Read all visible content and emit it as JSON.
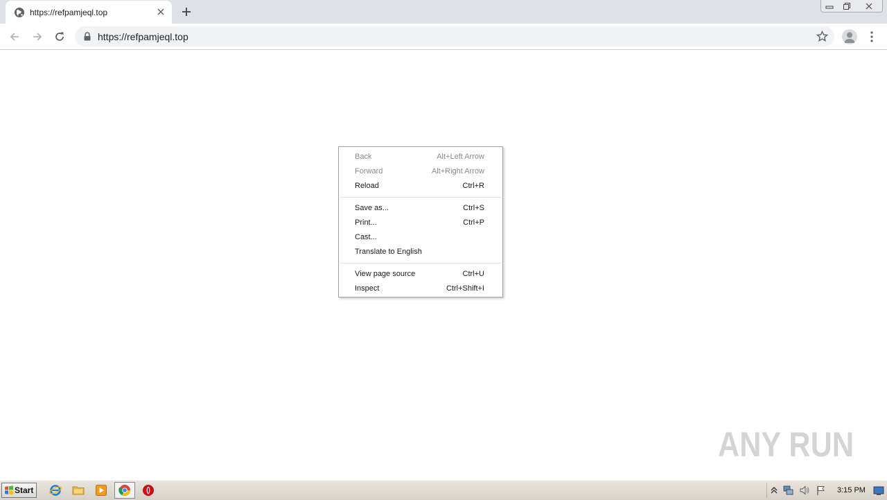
{
  "browser": {
    "tab_title": "https://refpamjeql.top",
    "url": "https://refpamjeql.top"
  },
  "context_menu": {
    "items": [
      {
        "label": "Back",
        "accel": "Alt+Left Arrow",
        "disabled": true
      },
      {
        "label": "Forward",
        "accel": "Alt+Right Arrow",
        "disabled": true
      },
      {
        "label": "Reload",
        "accel": "Ctrl+R",
        "disabled": false
      },
      {
        "label": "Save as...",
        "accel": "Ctrl+S",
        "disabled": false
      },
      {
        "label": "Print...",
        "accel": "Ctrl+P",
        "disabled": false
      },
      {
        "label": "Cast...",
        "accel": "",
        "disabled": false
      },
      {
        "label": "Translate to English",
        "accel": "",
        "disabled": false
      },
      {
        "label": "View page source",
        "accel": "Ctrl+U",
        "disabled": false
      },
      {
        "label": "Inspect",
        "accel": "Ctrl+Shift+I",
        "disabled": false
      }
    ]
  },
  "watermark": {
    "text": "ANY RUN"
  },
  "taskbar": {
    "start_label": "Start",
    "clock": "3:15 PM",
    "pinned": [
      "internet-explorer-icon",
      "file-explorer-icon",
      "media-player-icon",
      "chrome-icon",
      "opera-icon"
    ]
  },
  "colors": {
    "tabstrip": "#dee1e6",
    "omnibox": "#f1f3f4",
    "disabled_text": "#8a8a8a"
  }
}
